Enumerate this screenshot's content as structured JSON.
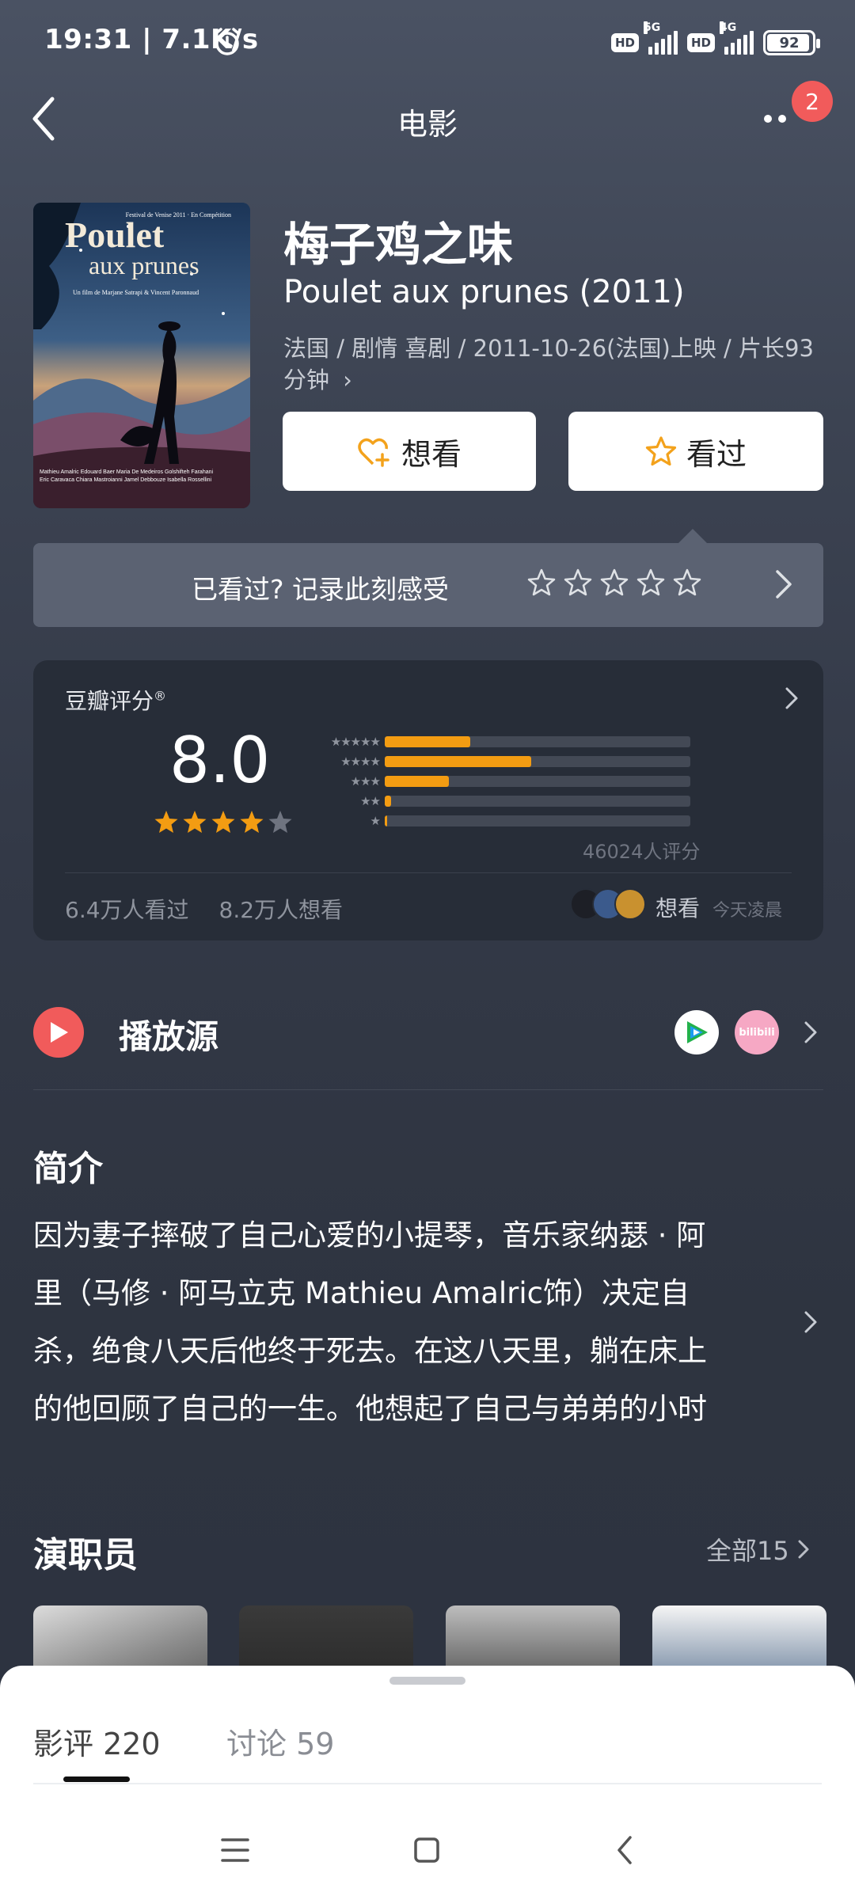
{
  "status_bar": {
    "time": "19:31 | 7.1K/s",
    "hd1": "HD",
    "net1": "5G",
    "hd2": "HD",
    "net2": "4G",
    "battery": "92"
  },
  "nav": {
    "title": "电影",
    "badge_count": "2"
  },
  "movie": {
    "title": "梅子鸡之味",
    "original_title": "Poulet aux prunes (2011)",
    "meta": "法国 / 剧情 喜剧 / 2011-10-26(法国)上映 / 片长93分钟",
    "meta_arrow": "›",
    "poster": {
      "festival_text": "Festival de Venise 2011 · En Compétition",
      "title_line1": "Poulet",
      "title_line2": "aux prunes",
      "credit": "Un film de Marjane Satrapi & Vincent Paronnaud",
      "cast_line1": "Mathieu Amalric  Edouard Baer  Maria De Medeiros  Golshifteh Farahani",
      "cast_line2": "Eric Caravaca  Chiara Mastroianni  Jamel Debbouze  Isabella Rossellini"
    }
  },
  "actions": {
    "want_label": "想看",
    "seen_label": "看过"
  },
  "record": {
    "text": "已看过? 记录此刻感受"
  },
  "rating": {
    "label": "豆瓣评分",
    "label_mark": "®",
    "score": "8.0",
    "stars": 4,
    "distribution": [
      {
        "stars": 5,
        "percent": 28
      },
      {
        "stars": 4,
        "percent": 48
      },
      {
        "stars": 3,
        "percent": 21
      },
      {
        "stars": 2,
        "percent": 2
      },
      {
        "stars": 1,
        "percent": 0.5
      }
    ],
    "count_text": "46024人评分",
    "seen_text": "6.4万人看过",
    "want_text": "8.2万人想看",
    "friends_action": "想看",
    "friends_time": "今天凌晨"
  },
  "play_source": {
    "title": "播放源",
    "bili_text": "bilibili"
  },
  "synopsis": {
    "title": "简介",
    "lines": [
      "因为妻子摔破了自己心爱的小提琴，音乐家纳瑟 · 阿",
      "里（马修 · 阿马立克 Mathieu Amalric饰）决定自",
      "杀，绝食八天后他终于死去。在这八天里，躺在床上",
      "的他回顾了自己的一生。他想起了自己与弟弟的小时"
    ]
  },
  "cast": {
    "title": "演职员",
    "all_label": "全部15"
  },
  "sheet": {
    "tab_reviews": "影评 220",
    "tab_discussions": "讨论 59"
  },
  "colors": {
    "accent_orange": "#f39c12",
    "badge_red": "#f15b5b"
  }
}
